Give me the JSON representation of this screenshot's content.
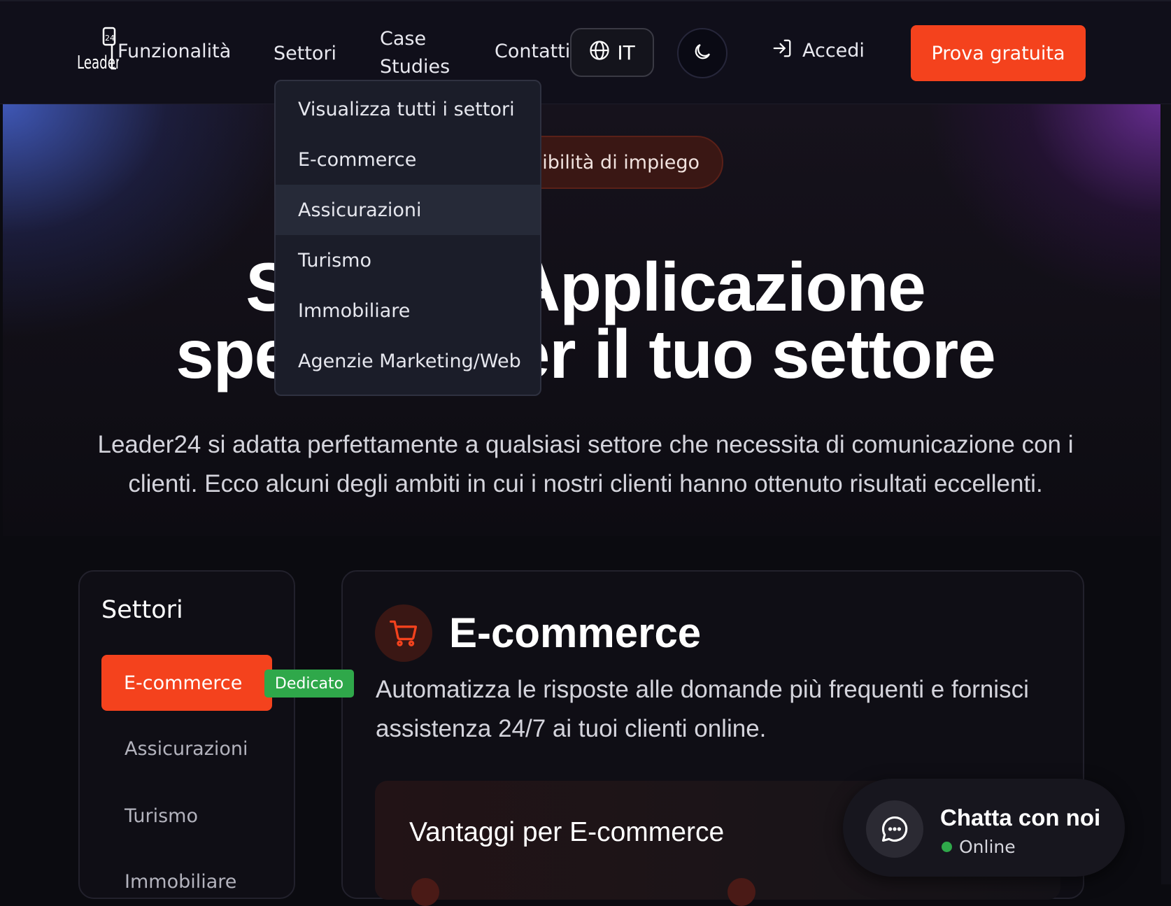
{
  "header": {
    "logo_text": "Leader24",
    "nav": {
      "features": "Funzionalità",
      "sectors": "Settori",
      "case_studies": "Case Studies",
      "contacts": "Contatti"
    },
    "language": "IT",
    "login": "Accedi",
    "cta": "Prova gratuita"
  },
  "dropdown": {
    "items": [
      "Visualizza tutti i settori",
      "E-commerce",
      "Assicurazioni",
      "Turismo",
      "Immobiliare",
      "Agenzie Marketing/Web"
    ],
    "hovered": "Assicurazioni"
  },
  "hero": {
    "badge": "sibilità di impiego",
    "title_line1": "S            Applicazione",
    "title_line2": "spe            er il tuo settore",
    "subtitle": "Leader24 si adatta perfettamente a qualsiasi settore che necessita di comunicazione con i clienti. Ecco alcuni degli ambiti in cui i nostri clienti hanno ottenuto risultati eccellenti."
  },
  "sidebar": {
    "title": "Settori",
    "active": "E-commerce",
    "active_tag": "Dedicato",
    "items": [
      "Assicurazioni",
      "Turismo",
      "Immobiliare"
    ]
  },
  "main": {
    "title": "E-commerce",
    "description": "Automatizza le risposte alle domande più frequenti e fornisci assistenza 24/7 ai tuoi clienti online.",
    "advantages_title": "Vantaggi per E-commerce"
  },
  "chat": {
    "title": "Chatta con noi",
    "status": "Online"
  },
  "colors": {
    "accent": "#f4421d",
    "success": "#2fa84a",
    "background": "#0b0b10"
  },
  "icons": [
    "logo-icon",
    "globe-icon",
    "moon-icon",
    "login-icon",
    "cart-icon",
    "chat-bubble-icon"
  ]
}
